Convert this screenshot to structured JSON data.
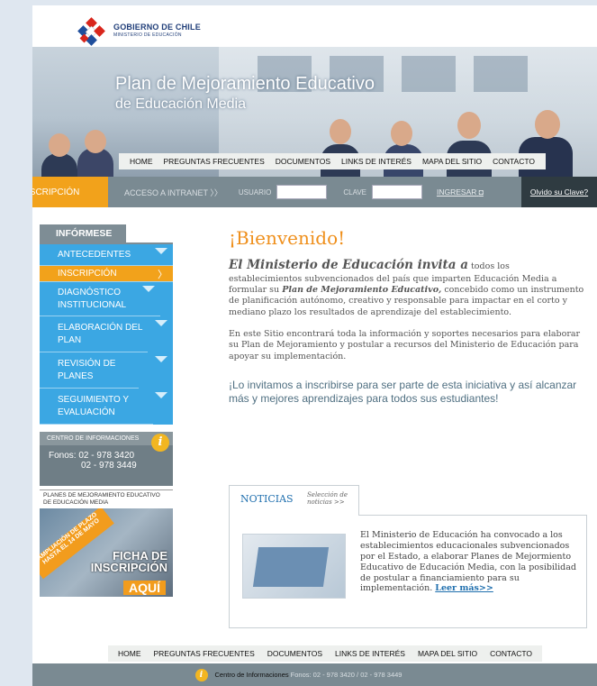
{
  "header": {
    "gov_line1": "GOBIERNO DE CHILE",
    "gov_line2": "MINISTERIO DE EDUCACIÓN",
    "banner_title": "Plan de Mejoramiento Educativo",
    "banner_subtitle": "de Educación Media"
  },
  "topnav": [
    "HOME",
    "PREGUNTAS FRECUENTES",
    "DOCUMENTOS",
    "LINKS DE INTERÉS",
    "MAPA DEL SITIO",
    "CONTACTO"
  ],
  "login_bar": {
    "inscripcion": "INSCRIPCIÓN",
    "acceso": "ACCESO A INTRANET",
    "usuario_label": "USUARIO",
    "usuario_value": "",
    "clave_label": "CLAVE",
    "clave_value": "",
    "ingresar": "INGRESAR",
    "olvido": "Olvido su Clave?"
  },
  "sidebar": {
    "informese": "INFÓRMESE",
    "items": [
      {
        "label": "ANTECEDENTES"
      },
      {
        "label": "INSCRIPCIÓN"
      },
      {
        "label": "DIAGNÓSTICO INSTITUCIONAL"
      },
      {
        "label": "ELABORACIÓN DEL PLAN"
      },
      {
        "label": "REVISIÓN DE PLANES"
      },
      {
        "label": "SEGUIMIENTO Y EVALUACIÓN"
      }
    ],
    "centro": {
      "title": "CENTRO DE INFORMACIONES",
      "fono1": "Fonos: 02 - 978 3420",
      "fono2": "02 - 978 3449"
    },
    "planes_title": "PLANES DE MEJORAMIENTO EDUCATIVO DE EDUCACIÓN MEDIA",
    "poster": {
      "ampliacion": "AMPLIACIÓN DE PLAZO HASTA EL 14 DE MAYO",
      "ficha": "FICHA DE INSCRIPCIÓN",
      "aqui": "AQUÍ"
    }
  },
  "main": {
    "welcome": "¡Bienvenido!",
    "lead_big": "El Ministerio de Educación invita a",
    "lead_rest1": " todos los establecimientos subvencionados del país que imparten Educación Media a formular su ",
    "lead_plan": "Plan de Mejoramiento Educativo,",
    "lead_rest2": " concebido como un instrumento de planificación autónomo, creativo y responsable para impactar en el corto y mediano plazo los resultados de aprendizaje del establecimiento.",
    "paragraph2": "En este Sitio encontrará toda la información y  soportes necesarios para elaborar su Plan de Mejoramiento y postular a recursos del Ministerio de Educación para apoyar su implementación.",
    "invite": "¡Lo invitamos a inscribirse para ser parte de esta iniciativa y así alcanzar más y mejores aprendizajes para todos sus estudiantes!"
  },
  "news": {
    "tab": "NOTICIAS",
    "selection": "Selección de noticias >>",
    "text": "El Ministerio de Educación ha convocado a los establecimientos educacionales subvencionados por el Estado, a elaborar Planes de Mejormiento Educativo de Educación Media, con la posibilidad de postular a financiamiento para su implementación. ",
    "more": "Leer más>>"
  },
  "footer": {
    "nav": [
      "HOME",
      "PREGUNTAS FRECUENTES",
      "DOCUMENTOS",
      "LINKS DE INTERÉS",
      "MAPA DEL SITIO",
      "CONTACTO"
    ],
    "centro": "Centro de Informaciones",
    "fonos": "Fonos: 02 - 978 3420 / 02 - 978 3449"
  },
  "colors": {
    "orange": "#f2a21b",
    "blue": "#3ba7e3",
    "gray": "#7a8a92",
    "dark": "#2f3b41"
  }
}
